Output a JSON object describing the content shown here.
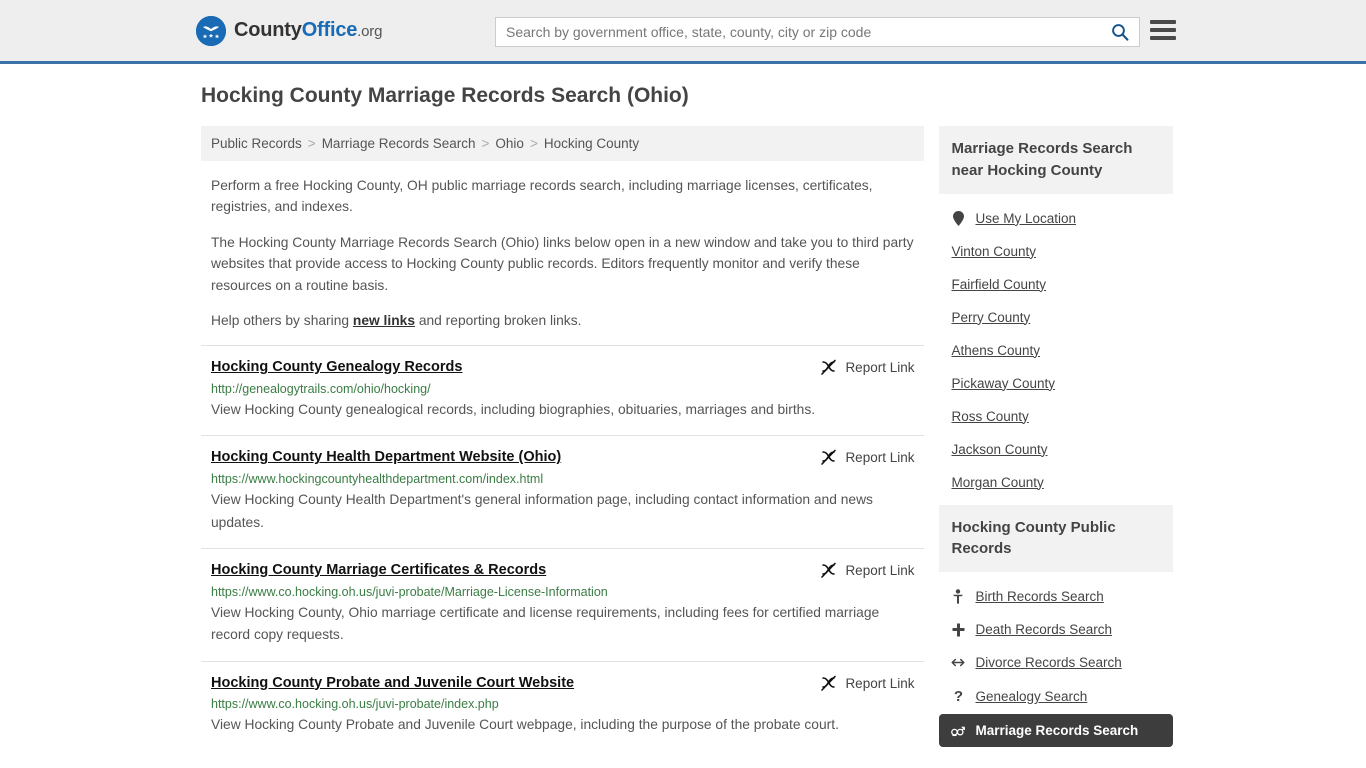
{
  "header": {
    "logo": {
      "part1": "County",
      "part2": "Office",
      "part3": ".org",
      "icon": "eagle-shield-icon"
    },
    "search": {
      "placeholder": "Search by government office, state, county, city or zip code",
      "value": "",
      "icon": "search-icon"
    },
    "menu_icon": "hamburger-menu-icon"
  },
  "page": {
    "title": "Hocking County Marriage Records Search (Ohio)"
  },
  "breadcrumb": {
    "items": [
      {
        "label": "Public Records"
      },
      {
        "label": "Marriage Records Search"
      },
      {
        "label": "Ohio"
      },
      {
        "label": "Hocking County"
      }
    ],
    "separator": ">"
  },
  "intro": {
    "p1": "Perform a free Hocking County, OH public marriage records search, including marriage licenses, certificates, registries, and indexes.",
    "p2": "The Hocking County Marriage Records Search (Ohio) links below open in a new window and take you to third party websites that provide access to Hocking County public records. Editors frequently monitor and verify these resources on a routine basis.",
    "p3_before": "Help others by sharing ",
    "p3_link": "new links",
    "p3_after": " and reporting broken links."
  },
  "results": {
    "report_label": "Report Link",
    "report_icon": "broken-link-icon",
    "items": [
      {
        "title": "Hocking County Genealogy Records",
        "url": "http://genealogytrails.com/ohio/hocking/",
        "description": "View Hocking County genealogical records, including biographies, obituaries, marriages and births."
      },
      {
        "title": "Hocking County Health Department Website (Ohio)",
        "url": "https://www.hockingcountyhealthdepartment.com/index.html",
        "description": "View Hocking County Health Department's general information page, including contact information and news updates."
      },
      {
        "title": "Hocking County Marriage Certificates & Records",
        "url": "https://www.co.hocking.oh.us/juvi-probate/Marriage-License-Information",
        "description": "View Hocking County, Ohio marriage certificate and license requirements, including fees for certified marriage record copy requests."
      },
      {
        "title": "Hocking County Probate and Juvenile Court Website",
        "url": "https://www.co.hocking.oh.us/juvi-probate/index.php",
        "description": "View Hocking County Probate and Juvenile Court webpage, including the purpose of the probate court."
      }
    ]
  },
  "sidebar": {
    "nearby": {
      "heading": "Marriage Records Search near Hocking County",
      "items": [
        {
          "label": "Use My Location",
          "icon": "map-pin-icon"
        },
        {
          "label": "Vinton County",
          "icon": ""
        },
        {
          "label": "Fairfield County",
          "icon": ""
        },
        {
          "label": "Perry County",
          "icon": ""
        },
        {
          "label": "Athens County",
          "icon": ""
        },
        {
          "label": "Pickaway County",
          "icon": ""
        },
        {
          "label": "Ross County",
          "icon": ""
        },
        {
          "label": "Jackson County",
          "icon": ""
        },
        {
          "label": "Morgan County",
          "icon": ""
        }
      ]
    },
    "public_records": {
      "heading": "Hocking County Public Records",
      "items": [
        {
          "label": "Birth Records Search",
          "icon": "baby-icon",
          "active": false
        },
        {
          "label": "Death Records Search",
          "icon": "cross-icon",
          "active": false
        },
        {
          "label": "Divorce Records Search",
          "icon": "left-right-arrow-icon",
          "active": false
        },
        {
          "label": "Genealogy Search",
          "icon": "question-mark-icon",
          "active": false
        },
        {
          "label": "Marriage Records Search",
          "icon": "male-female-icon",
          "active": true
        }
      ]
    }
  },
  "colors": {
    "brand_blue": "#1a6bb5",
    "header_border": "#3c72a8",
    "header_bg": "#eeeeee",
    "url_green": "#3a7d44",
    "active_bg": "#3d3d3d"
  }
}
